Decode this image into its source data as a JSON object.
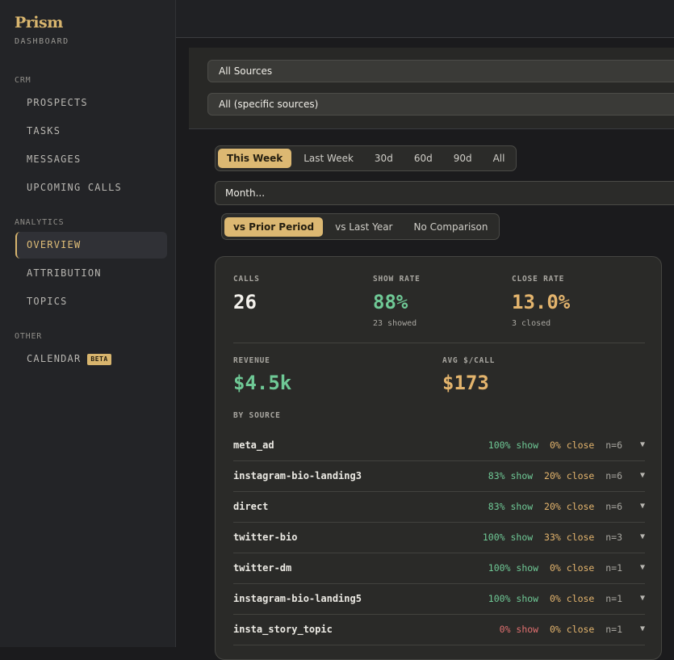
{
  "brand": {
    "name": "Prism",
    "subtitle": "DASHBOARD"
  },
  "sidebar": {
    "sections": [
      {
        "heading": "CRM",
        "items": [
          "PROSPECTS",
          "TASKS",
          "MESSAGES",
          "UPCOMING CALLS"
        ]
      },
      {
        "heading": "ANALYTICS",
        "items": [
          "OVERVIEW",
          "ATTRIBUTION",
          "TOPICS"
        ]
      },
      {
        "heading": "OTHER",
        "items": [
          "CALENDAR"
        ]
      }
    ],
    "active_item": "OVERVIEW",
    "calendar_badge": "BETA"
  },
  "filters": {
    "source_select": "All Sources",
    "specific_select": "All (specific sources)"
  },
  "range_tabs": [
    "This Week",
    "Last Week",
    "30d",
    "60d",
    "90d",
    "All"
  ],
  "range_active": "This Week",
  "month_select": "Month...",
  "comparison_tabs": [
    "vs Prior Period",
    "vs Last Year",
    "No Comparison"
  ],
  "comparison_active": "vs Prior Period",
  "stats": {
    "calls": {
      "label": "CALLS",
      "value": "26"
    },
    "show_rate": {
      "label": "SHOW RATE",
      "value": "88%",
      "sub": "23 showed"
    },
    "close_rate": {
      "label": "CLOSE RATE",
      "value": "13.0%",
      "sub": "3 closed"
    },
    "revenue": {
      "label": "REVENUE",
      "value": "$4.5k"
    },
    "avg_call": {
      "label": "AVG $/CALL",
      "value": "$173"
    }
  },
  "by_source": {
    "heading": "BY SOURCE",
    "rows": [
      {
        "name": "meta_ad",
        "show": "100% show",
        "close": "0% close",
        "n": "n=6",
        "show_color": "green"
      },
      {
        "name": "instagram-bio-landing3",
        "show": "83% show",
        "close": "20% close",
        "n": "n=6",
        "show_color": "green"
      },
      {
        "name": "direct",
        "show": "83% show",
        "close": "20% close",
        "n": "n=6",
        "show_color": "green"
      },
      {
        "name": "twitter-bio",
        "show": "100% show",
        "close": "33% close",
        "n": "n=3",
        "show_color": "green"
      },
      {
        "name": "twitter-dm",
        "show": "100% show",
        "close": "0% close",
        "n": "n=1",
        "show_color": "green"
      },
      {
        "name": "instagram-bio-landing5",
        "show": "100% show",
        "close": "0% close",
        "n": "n=1",
        "show_color": "green"
      },
      {
        "name": "insta_story_topic",
        "show": "0% show",
        "close": "0% close",
        "n": "n=1",
        "show_color": "red"
      }
    ]
  },
  "colors": {
    "accent": "#d8b56e",
    "green": "#6fc996",
    "gold": "#e3b46d",
    "red": "#e07070"
  }
}
